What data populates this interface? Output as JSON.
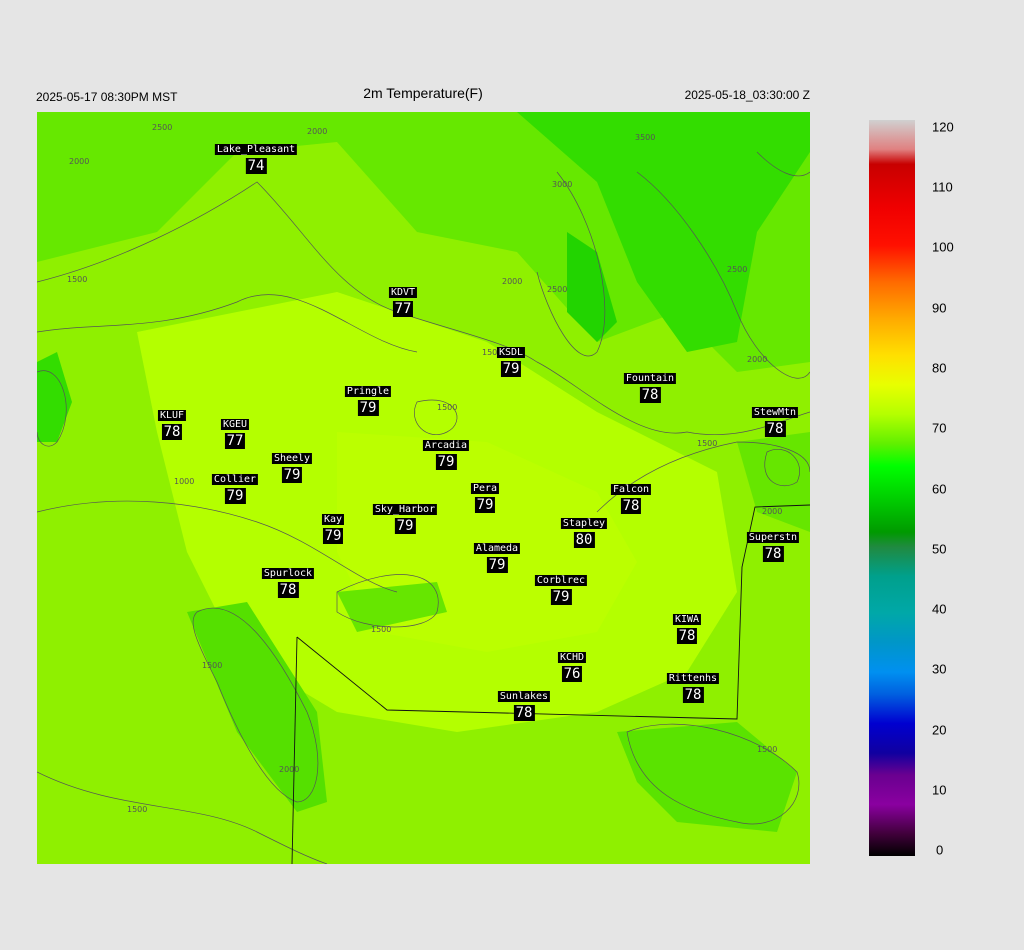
{
  "header": {
    "local_time": "2025-05-17 08:30PM MST",
    "title": "2m Temperature(F)",
    "utc_time": "2025-05-18_03:30:00 Z"
  },
  "stations": [
    {
      "name": "Lake_Pleasant",
      "value": "74"
    },
    {
      "name": "KDVT",
      "value": "77"
    },
    {
      "name": "KSDL",
      "value": "79"
    },
    {
      "name": "Fountain",
      "value": "78"
    },
    {
      "name": "StewMtn",
      "value": "78"
    },
    {
      "name": "Pringle",
      "value": "79"
    },
    {
      "name": "KLUF",
      "value": "78"
    },
    {
      "name": "KGEU",
      "value": "77"
    },
    {
      "name": "Arcadia",
      "value": "79"
    },
    {
      "name": "Sheely",
      "value": "79"
    },
    {
      "name": "Collier",
      "value": "79"
    },
    {
      "name": "Pera",
      "value": "79"
    },
    {
      "name": "Falcon",
      "value": "78"
    },
    {
      "name": "Kay",
      "value": "79"
    },
    {
      "name": "Sky_Harbor",
      "value": "79"
    },
    {
      "name": "Stapley",
      "value": "80"
    },
    {
      "name": "Superstn",
      "value": "78"
    },
    {
      "name": "Alameda",
      "value": "79"
    },
    {
      "name": "Spurlock",
      "value": "78"
    },
    {
      "name": "Corblrec",
      "value": "79"
    },
    {
      "name": "KIWA",
      "value": "78"
    },
    {
      "name": "KCHD",
      "value": "76"
    },
    {
      "name": "Rittenhs",
      "value": "78"
    },
    {
      "name": "Sunlakes",
      "value": "78"
    }
  ],
  "contour_labels": [
    "2500",
    "2000",
    "2000",
    "3000",
    "3500",
    "2000",
    "1500",
    "2500",
    "2500",
    "2000",
    "1500",
    "1500",
    "1500",
    "1000",
    "1500",
    "1500",
    "2000",
    "1500",
    "2000",
    "1500"
  ],
  "colorbar": {
    "ticks": [
      "120",
      "110",
      "100",
      "90",
      "80",
      "70",
      "60",
      "50",
      "40",
      "30",
      "20",
      "10",
      "0"
    ],
    "colors": [
      "#cccccc",
      "#c80000",
      "#ff0000",
      "#ff9600",
      "#c8ff00",
      "#00ff00",
      "#009600",
      "#00a0a0",
      "#0096e6",
      "#0000c8",
      "#7800a0",
      "#000000"
    ]
  }
}
